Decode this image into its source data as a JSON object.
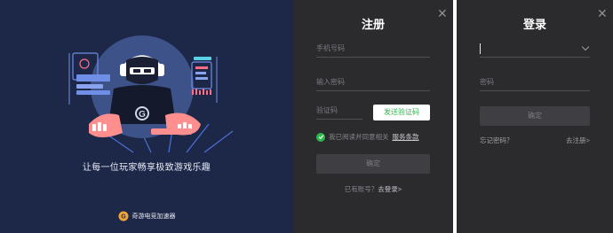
{
  "hero": {
    "tagline": "让每一位玩家畅享极致游戏乐趣",
    "brand_name": "奇游电竞加速器",
    "logo_letter": "G",
    "icons": [
      "gamer-illustration",
      "brand-logo"
    ]
  },
  "register": {
    "title": "注册",
    "close_label": "✕",
    "phone_placeholder": "手机号码",
    "password_placeholder": "输入密码",
    "code_placeholder": "验证码",
    "send_code_label": "发送验证码",
    "agree_text": "我已阅读并同意相关",
    "terms_link": "服务条款",
    "submit_label": "确定",
    "has_account_text": "已有账号？",
    "login_link": "去登录>"
  },
  "login": {
    "title": "登录",
    "close_label": "✕",
    "account_value": "",
    "password_placeholder": "密码",
    "submit_label": "确定",
    "forgot_label": "忘记密码？",
    "register_link": "去注册>"
  },
  "colors": {
    "hero_bg": "#1d2848",
    "panel_bg": "#2b2b2e",
    "accent_green": "#2db84d",
    "button_disabled": "#3f3f43"
  }
}
